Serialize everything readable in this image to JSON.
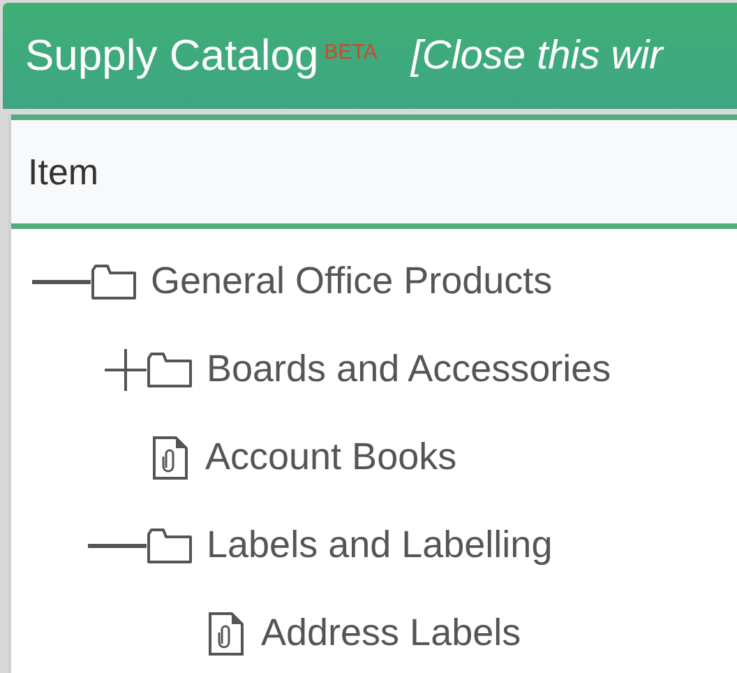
{
  "window": {
    "title": "Supply Catalog",
    "badge": "BETA",
    "close_hint": "[Close this wir"
  },
  "table": {
    "columns": [
      "Item"
    ],
    "tree": [
      {
        "label": "General Office Products",
        "kind": "folder",
        "expanded": true,
        "children": [
          {
            "label": "Boards and Accessories",
            "kind": "folder",
            "expanded": false
          },
          {
            "label": "Account Books",
            "kind": "item"
          },
          {
            "label": "Labels and Labelling",
            "kind": "folder",
            "expanded": true,
            "children": [
              {
                "label": "Address Labels",
                "kind": "item"
              }
            ]
          }
        ]
      }
    ]
  }
}
